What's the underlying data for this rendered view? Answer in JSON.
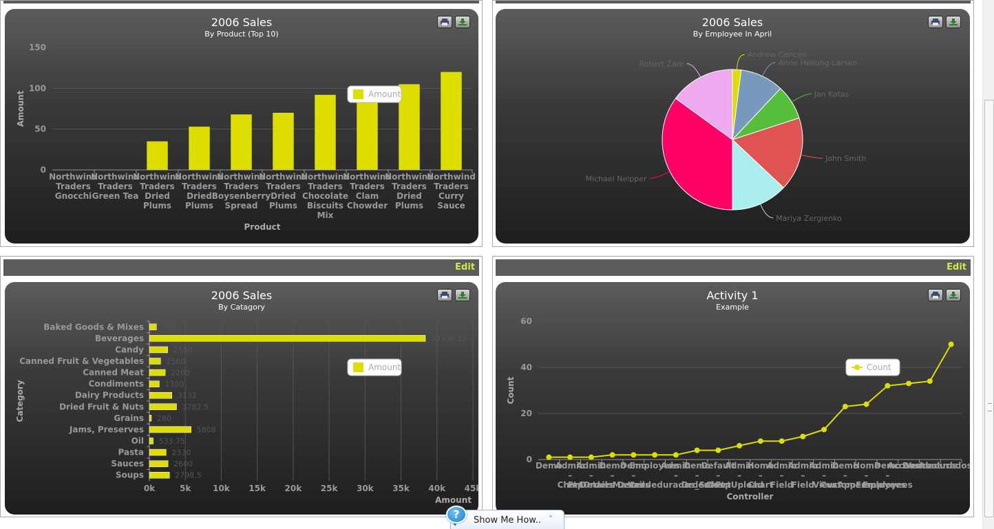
{
  "ui": {
    "edit_label": "Edit",
    "show_me_label": "Show Me How..",
    "help_glyph": "?",
    "icons": [
      "print-icon",
      "download-icon",
      "help-icon",
      "chevron-up-icon"
    ],
    "colors": {
      "accent": "#dddd00",
      "edit_link": "#d4e84a"
    }
  },
  "chart_data": [
    {
      "id": "product",
      "type": "bar",
      "title": "2006 Sales",
      "subtitle": "By Product (Top 10)",
      "xlabel": "Product",
      "ylabel": "Amount",
      "ylim": [
        0,
        150
      ],
      "yticks": [
        0,
        50,
        100,
        150
      ],
      "legend": [
        "Amount"
      ],
      "legend_position": "center-right",
      "grid": true,
      "categories": [
        [
          "Northwind",
          "Traders",
          "Gnocchi"
        ],
        [
          "Northwind",
          "Traders",
          "Green Tea"
        ],
        [
          "Northwind",
          "Traders",
          "Dried",
          "Plums"
        ],
        [
          "Northwind",
          "Traders",
          "Dried",
          "Plums"
        ],
        [
          "Northwind",
          "Traders",
          "Boysenberry",
          "Spread"
        ],
        [
          "Northwind",
          "Traders",
          "Dried",
          "Plums"
        ],
        [
          "Northwind",
          "Traders",
          "Chocolate",
          "Biscuits",
          "Mix"
        ],
        [
          "Northwind",
          "Traders",
          "Clam",
          "Chowder"
        ],
        [
          "Northwind",
          "Traders",
          "Dried",
          "Plums"
        ],
        [
          "Northwind",
          "Traders",
          "Curry",
          "Sauce"
        ]
      ],
      "values": [
        0,
        0,
        35,
        53,
        68,
        70,
        92,
        100,
        105,
        120
      ],
      "color": "#dddd00"
    },
    {
      "id": "employee",
      "type": "pie",
      "title": "2006 Sales",
      "subtitle": "By Employee In April",
      "slices": [
        {
          "name": "Andrew Cencini",
          "value": 2,
          "color": "#dddd00"
        },
        {
          "name": "Anne Hellung-Larsen",
          "value": 10,
          "color": "#7799bb"
        },
        {
          "name": "Jan Kotas",
          "value": 8,
          "color": "#55bf3b"
        },
        {
          "name": "John Smith",
          "value": 17,
          "color": "#df5353"
        },
        {
          "name": "Mariya Zergienko",
          "value": 13,
          "color": "#aaeeee"
        },
        {
          "name": "Michael Neipper",
          "value": 35,
          "color": "#ff0066"
        },
        {
          "name": "Robert Zare",
          "value": 15,
          "color": "#eeaaee"
        }
      ]
    },
    {
      "id": "category",
      "type": "bar",
      "orientation": "horizontal",
      "title": "2006 Sales",
      "subtitle": "By Catagory",
      "xlabel": "Amount",
      "ylabel": "Category",
      "xlim": [
        0,
        45000
      ],
      "xticks": [
        "0k",
        "5k",
        "10k",
        "15k",
        "20k",
        "25k",
        "30k",
        "35k",
        "40k",
        "45k"
      ],
      "legend": [
        "Amount"
      ],
      "legend_position": "center-right",
      "categories": [
        "Baked Goods & Mixes",
        "Beverages",
        "Candy",
        "Canned Fruit & Vegetables",
        "Canned Meat",
        "Condiments",
        "Dairy Products",
        "Dried Fruit & Nuts",
        "Grains",
        "Jams, Preserves",
        "Oil",
        "Pasta",
        "Sauces",
        "Soups"
      ],
      "values": [
        982,
        38396.25,
        2550,
        1560,
        2208,
        1380,
        3132,
        3782.5,
        280,
        5808,
        533.75,
        2330,
        2600,
        2798.5
      ],
      "value_labels": [
        "982",
        "38396.25",
        "2550",
        "1560",
        "2208",
        "1380",
        "3132",
        "3782.5",
        "280",
        "5808",
        "533.75",
        "2330",
        "2600",
        "2798.5"
      ],
      "color": "#dddd00"
    },
    {
      "id": "activity",
      "type": "line",
      "title": "Activity 1",
      "subtitle": "Example",
      "xlabel": "Controller",
      "ylabel": "Count",
      "ylim": [
        0,
        60
      ],
      "yticks": [
        0,
        20,
        40,
        60
      ],
      "legend": [
        "Count"
      ],
      "legend_position": "center-right",
      "categories": [
        [
          "Demo"
        ],
        [
          "Admin",
          "–",
          "Chart"
        ],
        [
          "Admin",
          "–",
          "FtpOrders"
        ],
        [
          "Demo",
          "–",
          "DetailsMaster"
        ],
        [
          "Demo",
          "–",
          "Details"
        ],
        [
          "Employees"
        ],
        [
          "Admin",
          "–",
          "Vendedurados_Sales"
        ],
        [
          "Demo",
          "–",
          "Orders"
        ],
        [
          "Default",
          "–",
          "Chart"
        ],
        [
          "Admin",
          "–",
          "FtpUpload"
        ],
        [
          "Home",
          "–",
          "Chart"
        ],
        [
          "Admin",
          "–",
          "Field"
        ],
        [
          "Admin",
          "–",
          "Field"
        ],
        [
          "Admin",
          "–",
          "View"
        ],
        [
          "Demo",
          "–",
          "Customers"
        ],
        [
          "Home",
          "–",
          "vxAppEmployees"
        ],
        [
          "Demo",
          "–",
          "Employees"
        ],
        [
          "Accounts"
        ],
        [
          "Dashboards"
        ],
        [
          "Vendedurados_User"
        ]
      ],
      "values": [
        1,
        1,
        1,
        2,
        2,
        2,
        2,
        4,
        4,
        6,
        8,
        8,
        10,
        13,
        23,
        24,
        32,
        33,
        34,
        50
      ],
      "color": "#dddd00"
    }
  ]
}
